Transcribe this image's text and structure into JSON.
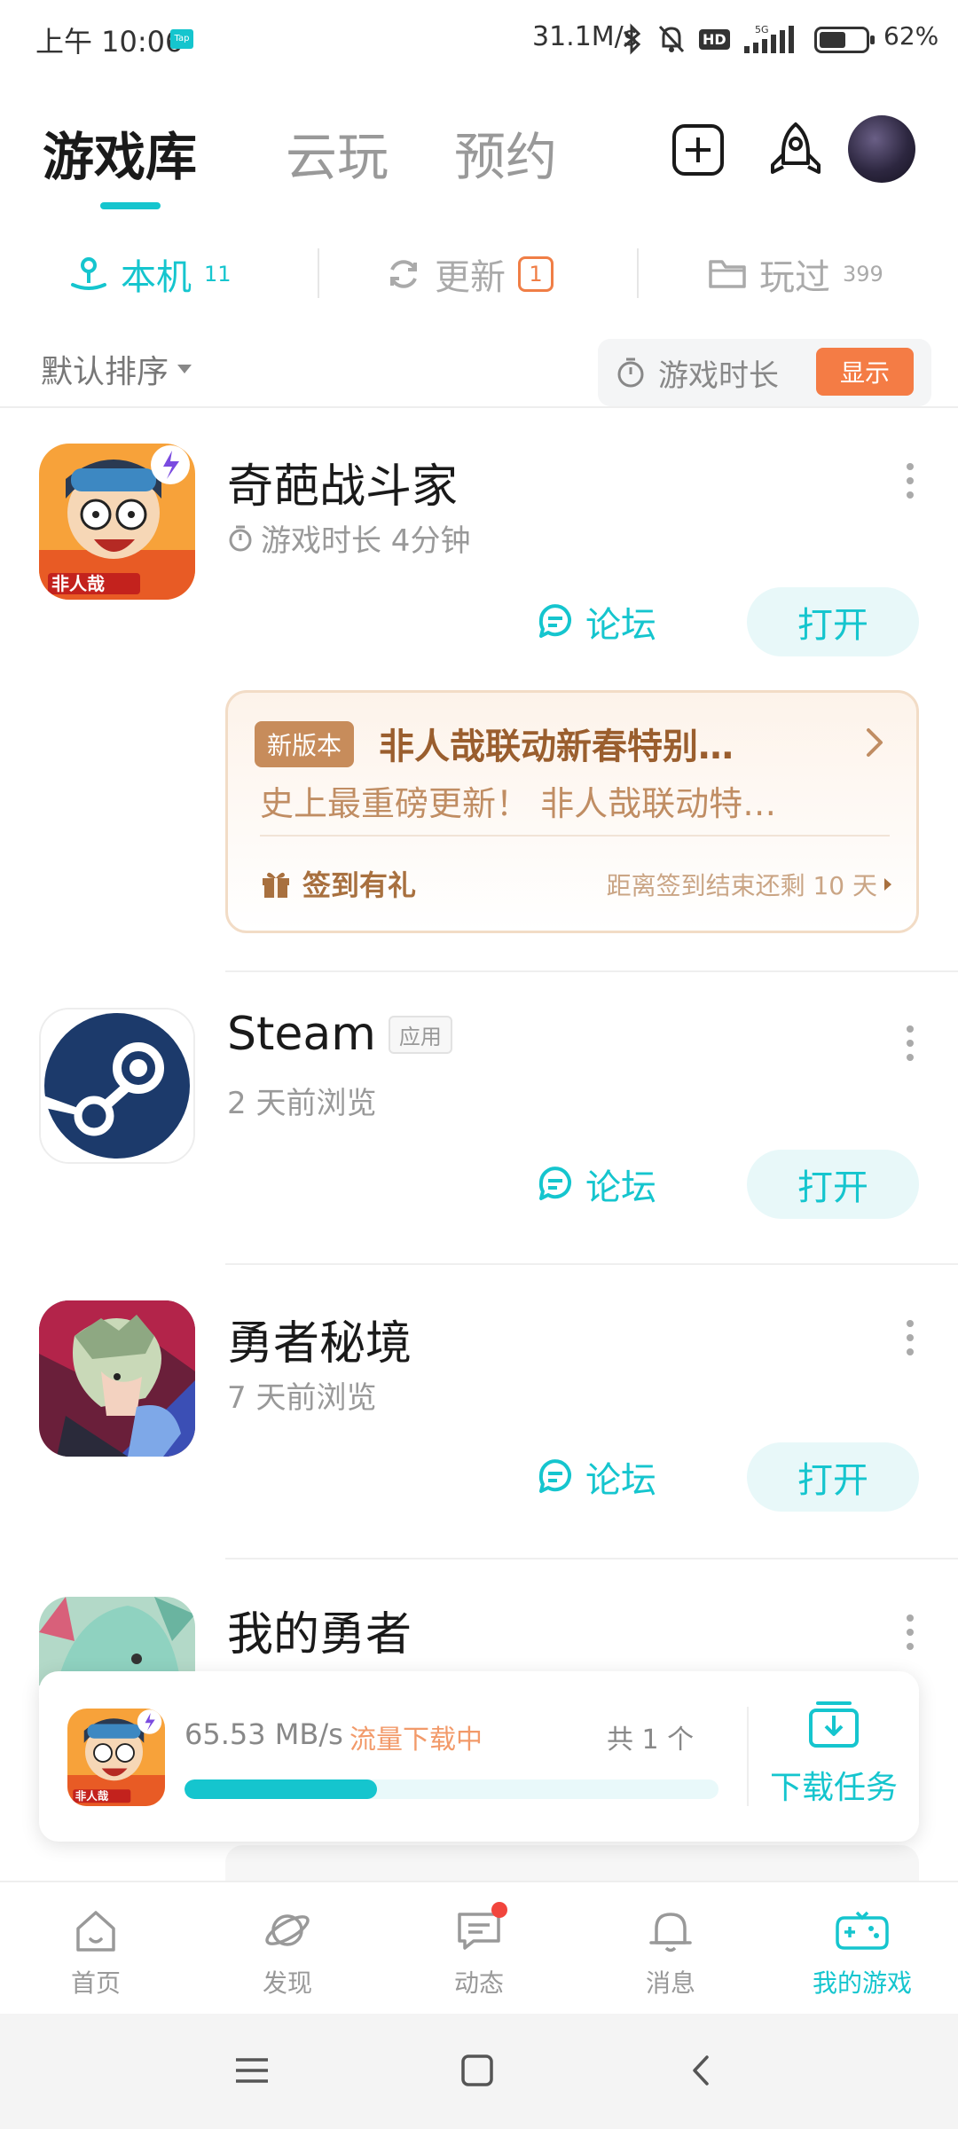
{
  "status_bar": {
    "time": "上午 10:06",
    "tap_badge": "Tap",
    "net_speed": "31.1M/s",
    "hd_label": "HD",
    "signal_label": "5G",
    "battery_level": 0.62,
    "battery_pct": "62%"
  },
  "top_tabs": [
    {
      "label": "游戏库",
      "active": true
    },
    {
      "label": "云玩",
      "active": false
    },
    {
      "label": "预约",
      "active": false
    }
  ],
  "header_icons": [
    "add-icon",
    "rocket-icon",
    "avatar"
  ],
  "sub_tabs": [
    {
      "label": "本机",
      "count": "11",
      "icon": "local-icon",
      "active": true
    },
    {
      "label": "更新",
      "count": "1",
      "icon": "refresh-icon",
      "active": false
    },
    {
      "label": "玩过",
      "count": "399",
      "icon": "folder-icon",
      "active": false
    }
  ],
  "sort": {
    "label": "默认排序",
    "playtime_label": "游戏时长",
    "show_button": "显示"
  },
  "games": [
    {
      "title": "奇葩战斗家",
      "tag": "",
      "subtitle": "游戏时长 4分钟",
      "forum": "论坛",
      "open": "打开"
    },
    {
      "title": "Steam",
      "tag": "应用",
      "subtitle": "2 天前浏览",
      "forum": "论坛",
      "open": "打开"
    },
    {
      "title": "勇者秘境",
      "tag": "",
      "subtitle": "7 天前浏览",
      "forum": "论坛",
      "open": "打开"
    },
    {
      "title": "我的勇者",
      "tag": "",
      "subtitle": "",
      "forum": "",
      "open": ""
    }
  ],
  "promo": {
    "tag": "新版本",
    "title": "非人哉联动新春特别…",
    "desc": "史上最重磅更新！ 非人哉联动特…",
    "checkin": "签到有礼",
    "remaining": "距离签到结束还剩 10 天"
  },
  "download": {
    "speed": "65.53 MB/s",
    "status": "流量下载中",
    "total": "共 1 个",
    "progress": 0.36,
    "task_label": "下载任务"
  },
  "bottom_nav": [
    {
      "label": "首页",
      "icon": "home-icon",
      "active": false
    },
    {
      "label": "发现",
      "icon": "planet-icon",
      "active": false
    },
    {
      "label": "动态",
      "icon": "chat-icon",
      "active": false,
      "dot": true
    },
    {
      "label": "消息",
      "icon": "bell-icon",
      "active": false
    },
    {
      "label": "我的游戏",
      "icon": "gamepad-icon",
      "active": true
    }
  ],
  "colors": {
    "accent": "#15c5ce",
    "orange": "#f47c45",
    "promo_brown": "#9a5e2e"
  }
}
